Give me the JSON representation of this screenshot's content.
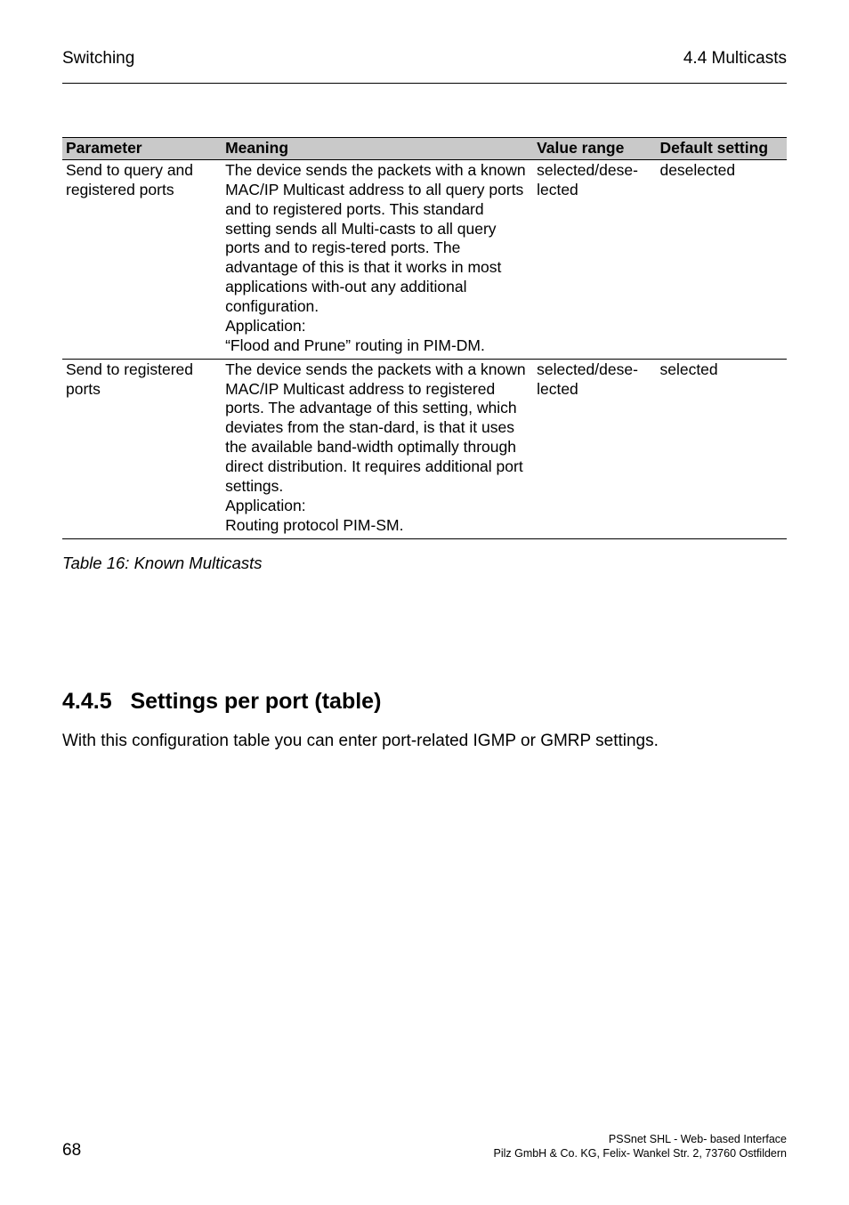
{
  "header": {
    "left": "Switching",
    "right": "4.4 Multicasts"
  },
  "table": {
    "headers": {
      "parameter": "Parameter",
      "meaning": "Meaning",
      "range": "Value range",
      "default": "Default setting"
    },
    "rows": [
      {
        "parameter": "Send to query and registered ports",
        "meaning": "The device sends the packets with a known MAC/IP Multicast address to all query ports and to registered ports. This standard setting sends all Multi-casts to all query ports and to regis-tered ports. The advantage of this is that it works in most applications with-out any additional configuration.\nApplication:\n“Flood and Prune” routing in PIM-DM.",
        "range": "selected/dese-lected",
        "default": "deselected"
      },
      {
        "parameter": "Send to registered ports",
        "meaning": "The device sends the packets with a known MAC/IP Multicast address to registered ports. The advantage of this setting, which deviates from the stan-dard, is that it uses the available band-width optimally through direct distribution. It requires additional port settings.\nApplication:\nRouting protocol PIM-SM.",
        "range": "selected/dese-lected",
        "default": "selected"
      }
    ],
    "caption": "Table 16: Known Multicasts"
  },
  "section": {
    "number": "4.4.5",
    "title": "Settings per port (table)",
    "body": "With this configuration table you can enter port-related IGMP or GMRP settings."
  },
  "footer": {
    "page": "68",
    "line1": "PSSnet SHL - Web- based Interface",
    "line2": "Pilz GmbH & Co. KG, Felix- Wankel Str. 2, 73760 Ostfildern"
  },
  "chart_data": {
    "type": "table",
    "title": "Known Multicasts",
    "columns": [
      "Parameter",
      "Meaning",
      "Value range",
      "Default setting"
    ],
    "rows": [
      [
        "Send to query and registered ports",
        "The device sends the packets with a known MAC/IP Multicast address to all query ports and to registered ports. This standard setting sends all Multicasts to all query ports and to registered ports. The advantage of this is that it works in most applications without any additional configuration. Application: \"Flood and Prune\" routing in PIM-DM.",
        "selected/deselected",
        "deselected"
      ],
      [
        "Send to registered ports",
        "The device sends the packets with a known MAC/IP Multicast address to registered ports. The advantage of this setting, which deviates from the standard, is that it uses the available bandwidth optimally through direct distribution. It requires additional port settings. Application: Routing protocol PIM-SM.",
        "selected/deselected",
        "selected"
      ]
    ]
  }
}
